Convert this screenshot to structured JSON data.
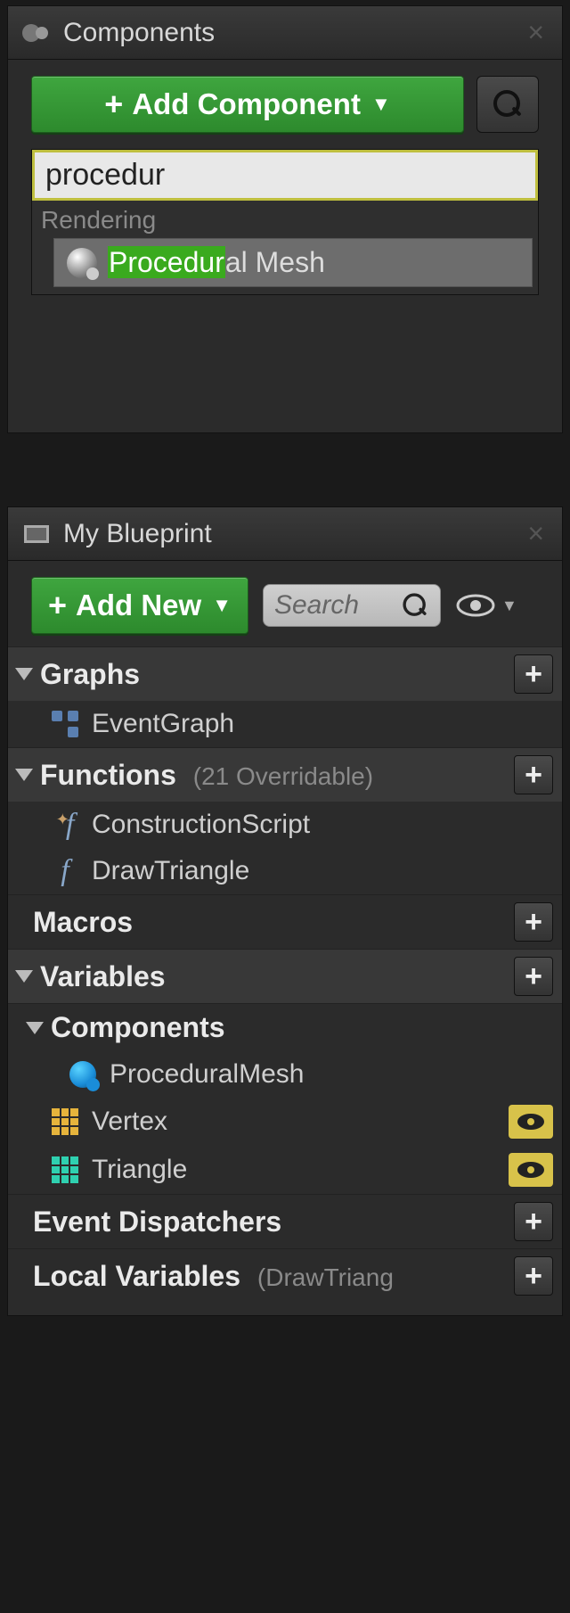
{
  "components_panel": {
    "title": "Components",
    "add_button": "Add Component",
    "search_value": "procedur",
    "category": "Rendering",
    "result": {
      "highlight": "Procedur",
      "rest": "al Mesh",
      "full": "Procedural Mesh"
    }
  },
  "blueprint_panel": {
    "title": "My Blueprint",
    "add_button": "Add New",
    "search_placeholder": "Search",
    "sections": {
      "graphs": {
        "title": "Graphs"
      },
      "functions": {
        "title": "Functions",
        "sub": "(21 Overridable)"
      },
      "macros": {
        "title": "Macros"
      },
      "variables": {
        "title": "Variables"
      },
      "components": {
        "title": "Components"
      },
      "dispatchers": {
        "title": "Event Dispatchers"
      },
      "locals": {
        "title": "Local Variables",
        "sub": "(DrawTriang"
      }
    },
    "items": {
      "event_graph": "EventGraph",
      "construction": "ConstructionScript",
      "drawtri": "DrawTriangle",
      "procmesh": "ProceduralMesh",
      "vertex": "Vertex",
      "triangle": "Triangle"
    }
  }
}
